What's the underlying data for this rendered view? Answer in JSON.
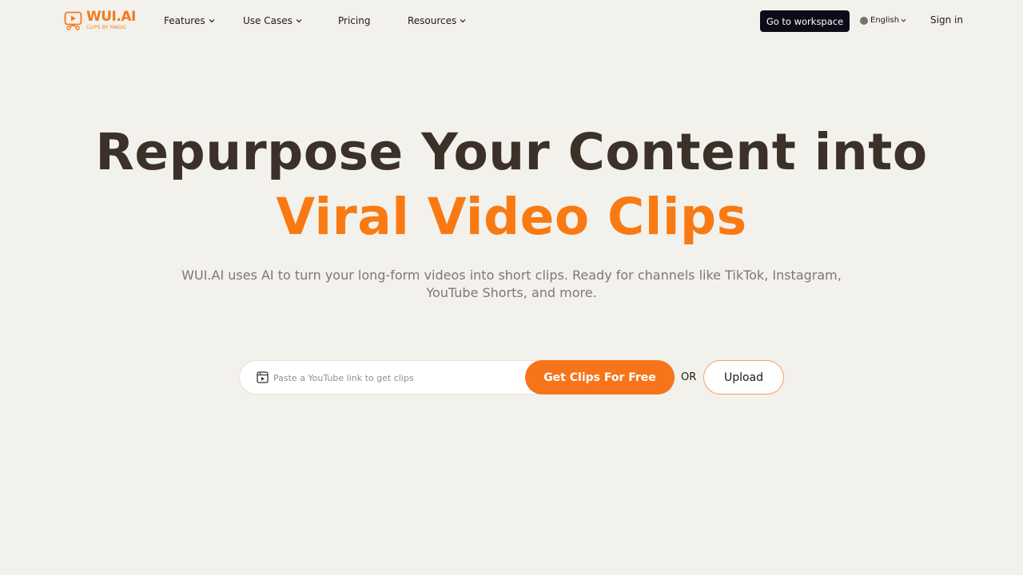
{
  "brand": {
    "name": "WUI.AI",
    "tagline": "CLIPS BY MAGIC",
    "accent_color": "#f47a1f"
  },
  "nav": {
    "items": [
      {
        "label": "Features",
        "has_dropdown": true
      },
      {
        "label": "Use Cases",
        "has_dropdown": true
      },
      {
        "label": "Pricing",
        "has_dropdown": false
      },
      {
        "label": "Resources",
        "has_dropdown": true
      }
    ],
    "workspace_label": "Go to workspace",
    "language_label": "English",
    "signin_label": "Sign in"
  },
  "hero": {
    "title_line1": "Repurpose Your Content into",
    "title_line2": "Viral Video Clips",
    "subtitle": "WUI.AI uses AI to turn your long-form videos into short clips. Ready for channels like TikTok, Instagram, YouTube Shorts, and more."
  },
  "cta": {
    "search_placeholder": "Paste a YouTube link to get clips",
    "search_value": "",
    "get_clips_label": "Get Clips For Free",
    "or_label": "OR",
    "upload_label": "Upload"
  },
  "colors": {
    "background": "#f3f1ec",
    "primary_button": "#f7741a",
    "dark_button": "#0d0b17",
    "title_dark": "#3b3128",
    "title_accent": "#f97a13"
  }
}
